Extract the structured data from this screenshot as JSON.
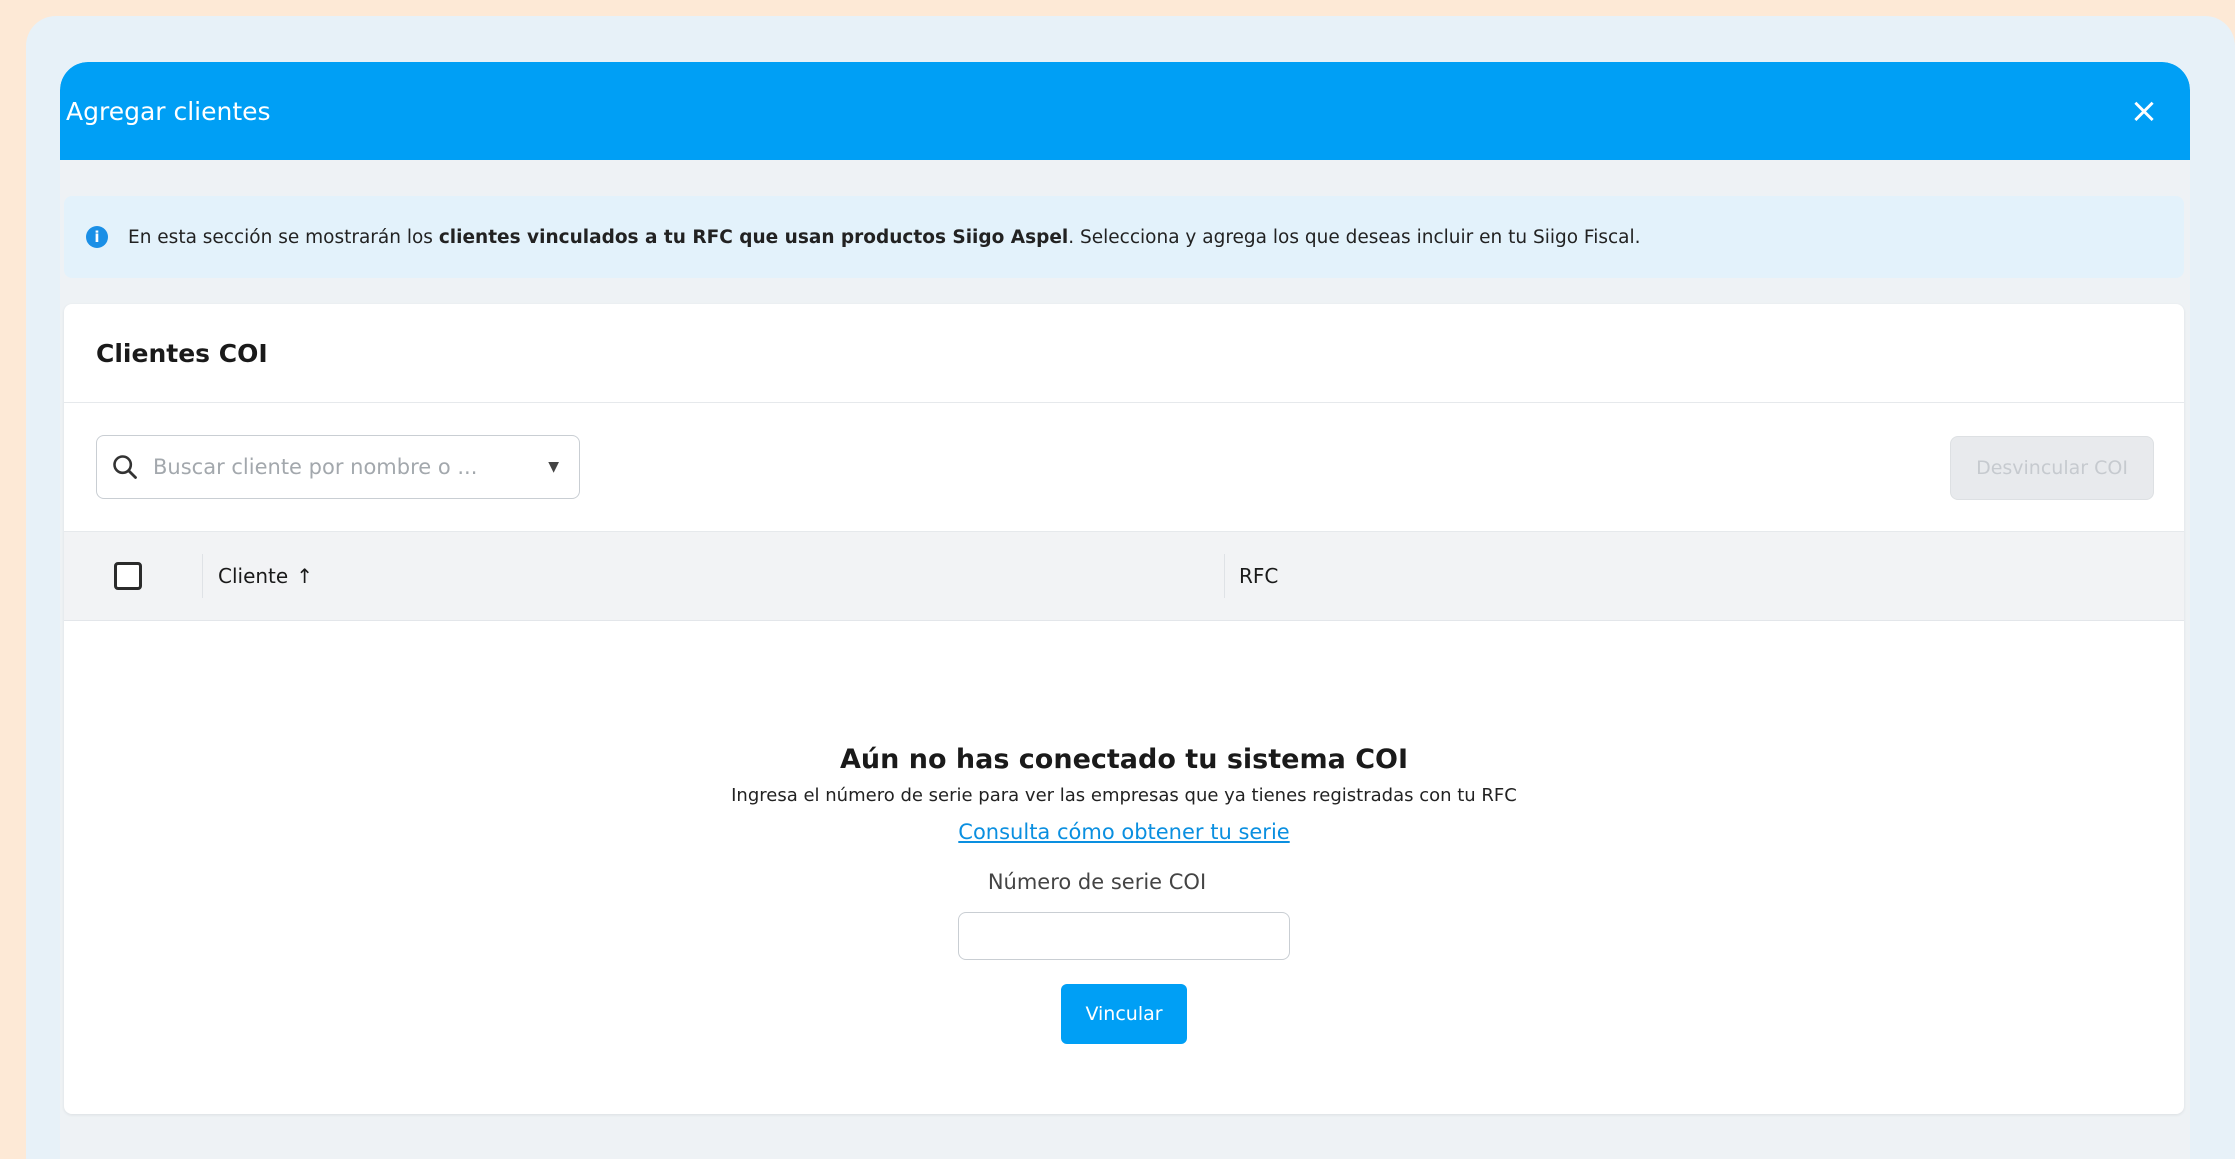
{
  "modal": {
    "title": "Agregar clientes",
    "close_glyph": "×"
  },
  "info": {
    "icon": "i",
    "text_prefix": "En esta sección se mostrarán los ",
    "text_bold": "clientes vinculados a tu RFC que usan productos Siigo Aspel",
    "text_suffix": ". Selecciona y agrega los que deseas incluir en tu Siigo Fiscal."
  },
  "card": {
    "title": "Clientes COI"
  },
  "search": {
    "placeholder": "Buscar cliente por nombre o ...",
    "dropdown_glyph": "▼"
  },
  "toolbar": {
    "unlink_label": "Desvincular COI"
  },
  "table": {
    "columns": [
      "Cliente",
      "RFC"
    ],
    "sort_glyph": "↑"
  },
  "empty_state": {
    "title": "Aún no has conectado tu sistema COI",
    "description": "Ingresa el número de serie para ver las empresas que ya tienes registradas con tu RFC",
    "link": "Consulta cómo obtener tu serie",
    "field_label": "Número de serie COI",
    "field_value": "",
    "button": "Vincular"
  },
  "colors": {
    "primary": "#009ff5",
    "background": "#fde9d6"
  }
}
